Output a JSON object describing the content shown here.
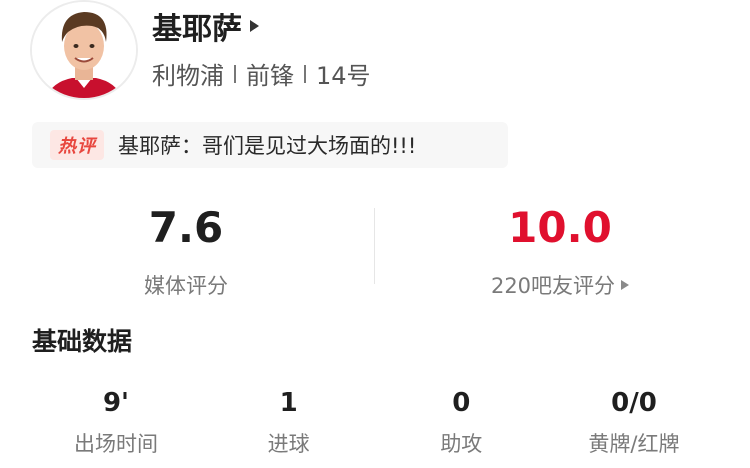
{
  "player": {
    "name": "基耶萨",
    "team": "利物浦",
    "position": "前锋",
    "number": "14号"
  },
  "hot_comment": {
    "badge": "热评",
    "text": "基耶萨：哥们是见过大场面的!!!"
  },
  "ratings": {
    "media": {
      "value": "7.6",
      "label": "媒体评分"
    },
    "fans": {
      "value": "10.0",
      "label": "220吧友评分"
    }
  },
  "basic_stats": {
    "title": "基础数据",
    "items": [
      {
        "value": "9'",
        "label": "出场时间"
      },
      {
        "value": "1",
        "label": "进球"
      },
      {
        "value": "0",
        "label": "助攻"
      },
      {
        "value": "0/0",
        "label": "黄牌/红牌"
      }
    ]
  },
  "colors": {
    "fans_rating": "#e0102e",
    "hot_badge": "#e8473f"
  }
}
